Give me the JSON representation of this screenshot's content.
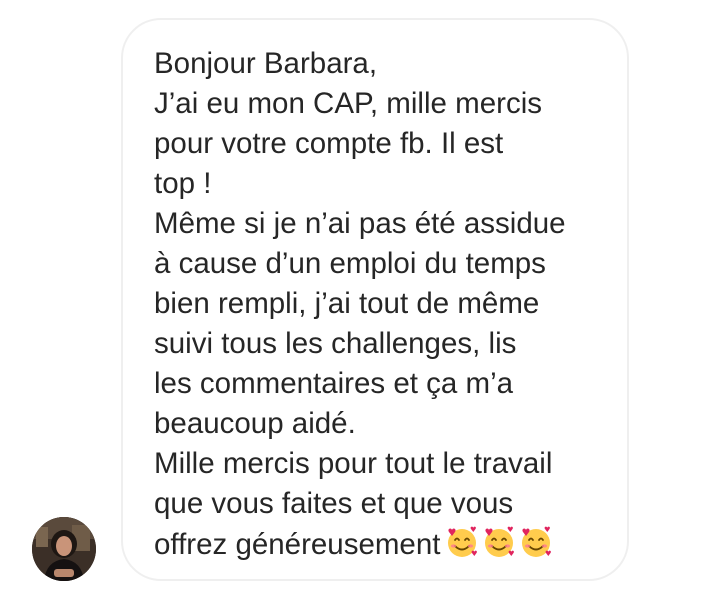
{
  "message": {
    "lines": [
      "Bonjour Barbara,",
      "J’ai eu mon CAP, mille mercis",
      "pour votre compte fb. Il est",
      "top !",
      "Même si je n’ai pas été assidue",
      "à cause d’un emploi du temps",
      "bien rempli, j’ai tout de même",
      "suivi tous les challenges, lis",
      "les commentaires et ça m’a",
      "beaucoup aidé.",
      "Mille mercis pour tout le travail",
      "que vous faites et que vous",
      "offrez généreusement"
    ],
    "emojis": [
      "smiling-face-with-hearts",
      "smiling-face-with-hearts",
      "smiling-face-with-hearts"
    ]
  },
  "colors": {
    "text": "#262626",
    "bubble_border": "#efefef",
    "background": "#ffffff"
  }
}
